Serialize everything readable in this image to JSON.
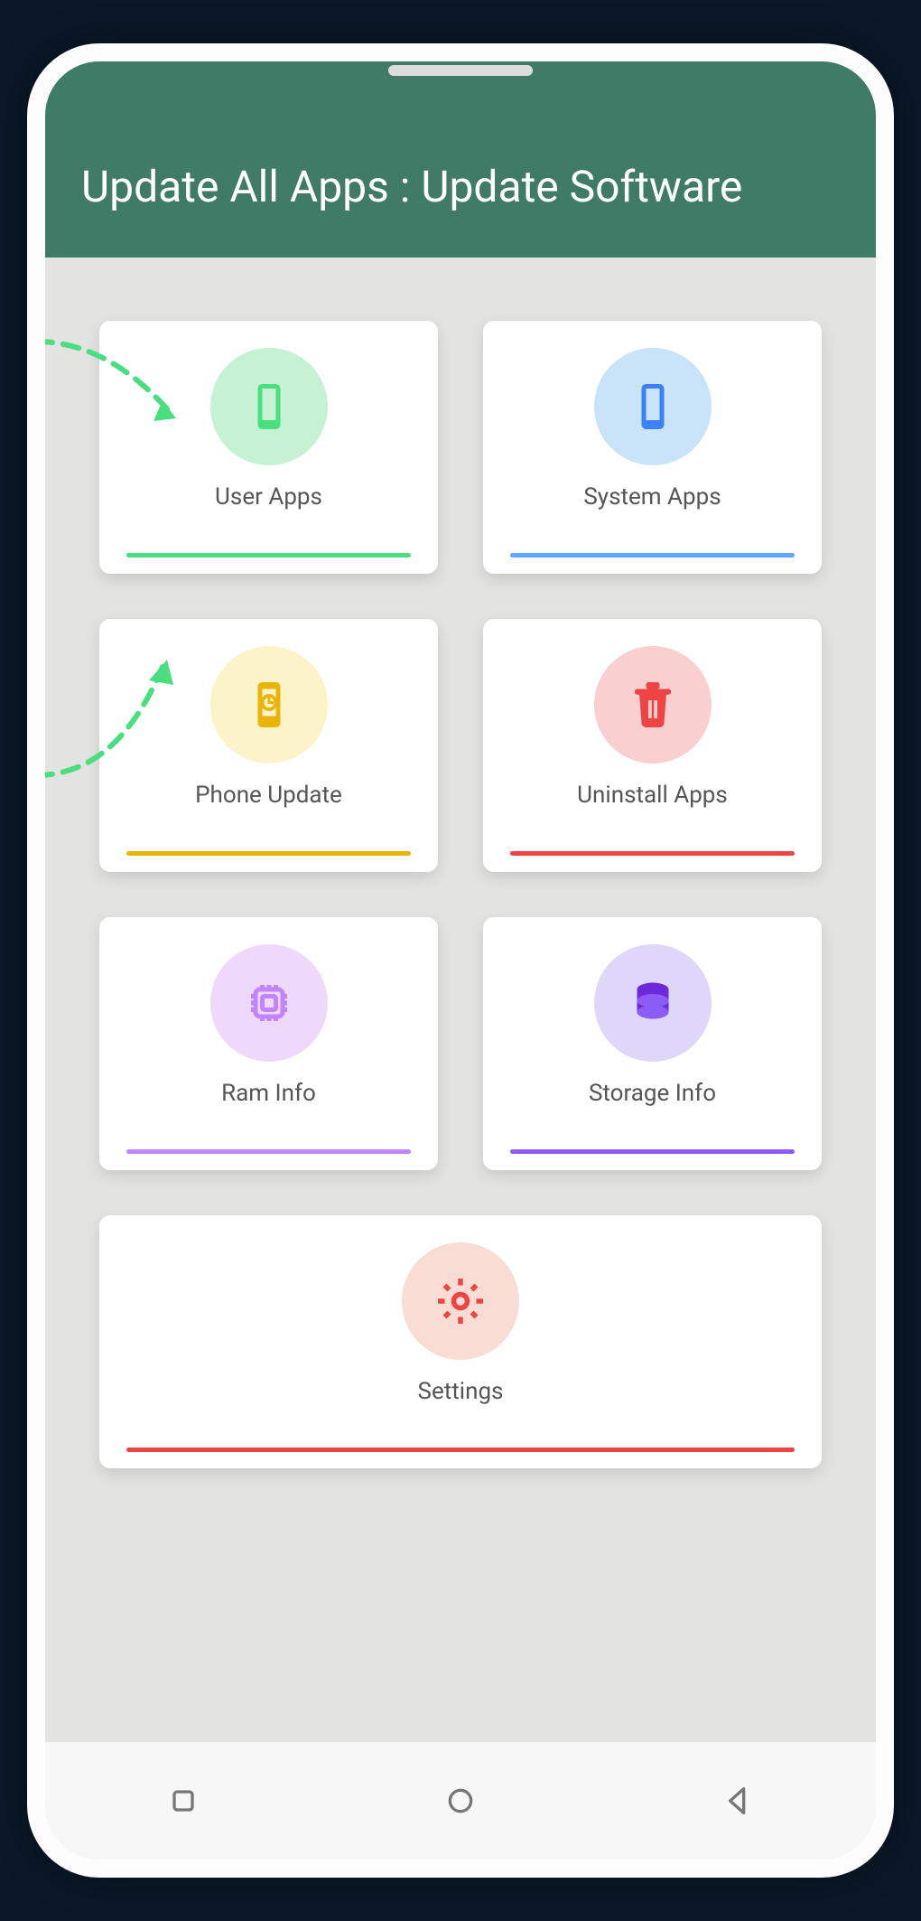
{
  "header": {
    "title": "Update All Apps : Update Software"
  },
  "cards": [
    {
      "label": "User Apps",
      "color": "#4ade80",
      "bg": "#c4f2d2",
      "icon": "phone"
    },
    {
      "label": "System Apps",
      "color": "#3b82f6",
      "bg": "#c9e4f8",
      "icon": "phone"
    },
    {
      "label": "Phone Update",
      "color": "#eab308",
      "bg": "#fdf3c8",
      "icon": "update"
    },
    {
      "label": "Uninstall Apps",
      "color": "#ef4444",
      "bg": "#f9cfcf",
      "icon": "trash"
    },
    {
      "label": "Ram Info",
      "color": "#c084fc",
      "bg": "#eed9fb",
      "icon": "chip"
    },
    {
      "label": "Storage Info",
      "color": "#6d28d9",
      "bg": "#ded7fa",
      "icon": "storage"
    },
    {
      "label": "Settings",
      "color": "#ef4444",
      "bg": "#f9dcd4",
      "icon": "gear"
    }
  ]
}
